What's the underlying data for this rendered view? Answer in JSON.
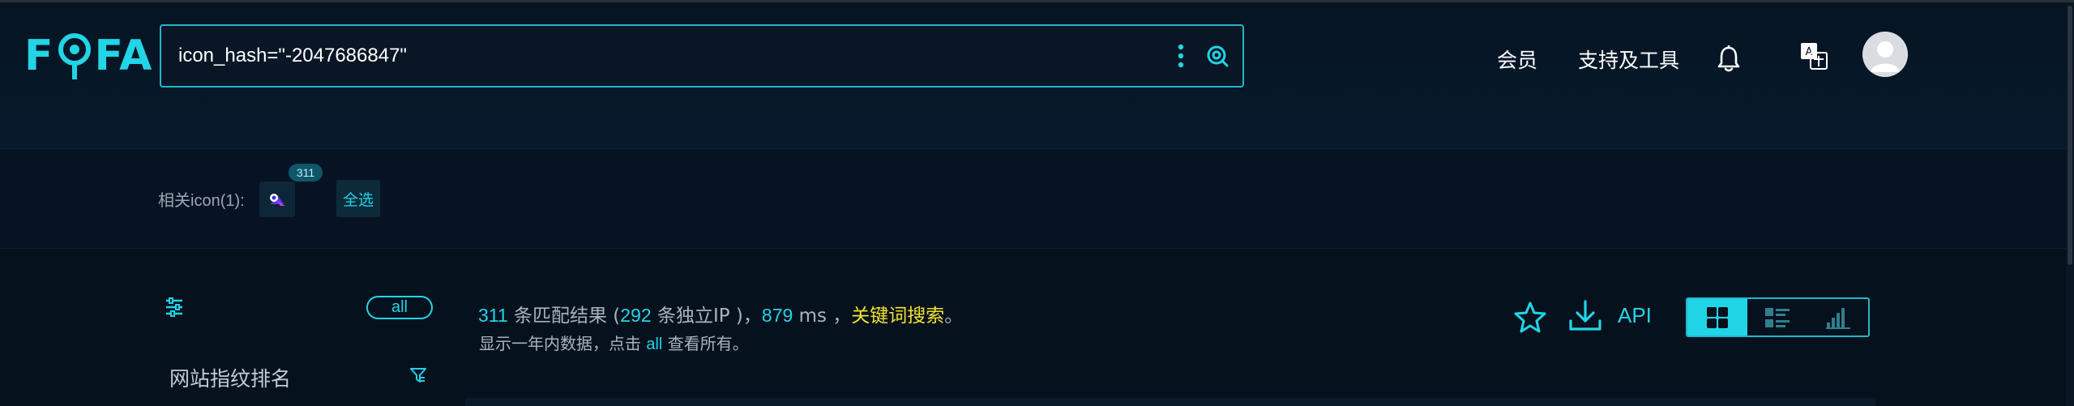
{
  "header": {
    "logo_text_left": "F",
    "logo_text_right": "FA",
    "search": {
      "value": "icon_hash=\"-2047686847\""
    },
    "nav": {
      "member_label": "会员",
      "tools_label": "支持及工具"
    },
    "icons": [
      "more-vertical-icon",
      "search-icon",
      "bell-icon",
      "translate-icon"
    ],
    "accent_color": "#21d4e6"
  },
  "related": {
    "label": "相关icon(1):",
    "icon_count": "311",
    "select_all_label": "全选"
  },
  "results": {
    "all_label": "all",
    "rank_title": "网站指纹排名",
    "summary": {
      "count": "311",
      "count_suffix": " 条匹配结果 (",
      "unique_ip": "292",
      "unique_ip_suffix": " 条独立IP )，",
      "time": "879",
      "time_suffix": " ms ，",
      "keyword_search": "关键词搜索",
      "end": "。"
    },
    "subline": {
      "prefix": "显示一年内数据，点击 ",
      "link": "all",
      "suffix": " 查看所有。"
    },
    "api_label": "API",
    "view_modes": [
      "grid-view-icon",
      "list-view-icon",
      "chart-view-icon"
    ],
    "active_view": "grid"
  }
}
